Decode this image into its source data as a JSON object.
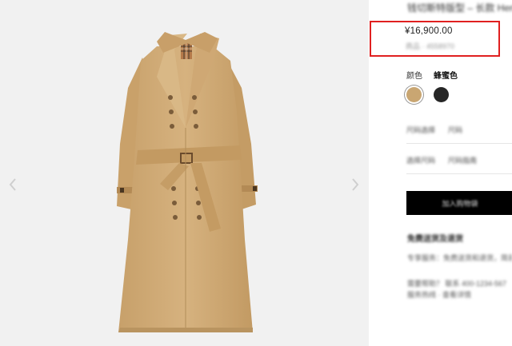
{
  "product": {
    "title": "钱切斯特版型 – 长款 Heritage",
    "price": "¥16,900.00",
    "price_note": "商品 · 4558970",
    "colors": {
      "label": "颜色",
      "selected": "蜂蜜色",
      "swatches": [
        {
          "name": "蜂蜜色",
          "hex": "#c9a672"
        },
        {
          "name": "黑色",
          "hex": "#262626"
        }
      ]
    },
    "details": [
      {
        "key": "尺码选择",
        "value": "尺码"
      },
      {
        "key": "选择尺码",
        "value": "尺码指南"
      }
    ],
    "add_to_cart": "加入购物袋",
    "section_heading": "免费送货及退货",
    "info_lines": [
      "专享服务：免费送货和退货，简易",
      "需要帮助？ 联系 400-1234-567",
      "服务热线 · 查看详情"
    ]
  },
  "gallery": {
    "prev_icon": "chevron-left-icon",
    "next_icon": "chevron-right-icon",
    "coat_color": "#d1ad7a",
    "background": "#f1f1f1"
  },
  "highlight_color": "#e02020"
}
